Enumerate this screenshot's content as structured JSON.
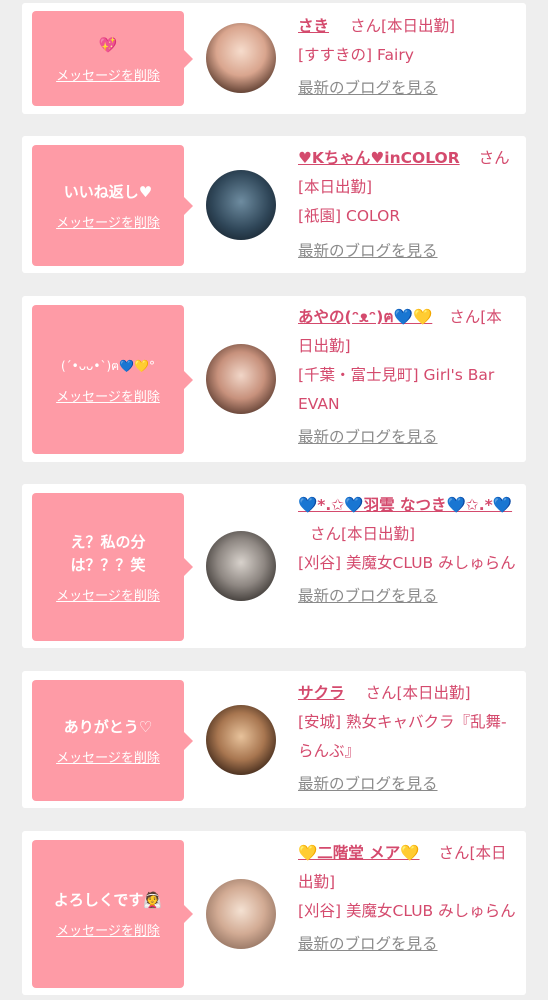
{
  "cards": [
    {
      "message": "💖",
      "delete_label": "メッセージを削除",
      "name": "さき",
      "san_status": "さん[本日出勤]",
      "shop": "[すすきの] Fairy",
      "blog_label": "最新のブログを見る"
    },
    {
      "message": "いいね返し♥",
      "delete_label": "メッセージを削除",
      "name": "♥Kちゃん♥inCOLOR",
      "san_status": "さん[本日出勤]",
      "shop": "[祇園] COLOR",
      "blog_label": "最新のブログを見る"
    },
    {
      "message": "(´•ᴗᴗ•`)ฅ💙💛°",
      "delete_label": "メッセージを削除",
      "name": "あやの(ᵔᴥᵔ)ฅ💙💛",
      "san_status": "さん[本日出勤]",
      "shop": "[千葉・富士見町] Girl's Bar EVAN",
      "blog_label": "最新のブログを見る"
    },
    {
      "message": "え？私の分は？？？笑",
      "delete_label": "メッセージを削除",
      "name": "💙*.✩💙羽雲 なつき💙✩.*💙",
      "san_status": "さん[本日出勤]",
      "shop": "[刈谷] 美魔女CLUB みしゅらん",
      "blog_label": "最新のブログを見る"
    },
    {
      "message": "ありがとう♡",
      "delete_label": "メッセージを削除",
      "name": "サクラ",
      "san_status": "さん[本日出勤]",
      "shop": "[安城] 熟女キャバクラ『乱舞-らんぶ』",
      "blog_label": "最新のブログを見る"
    },
    {
      "message": "よろしくです👰",
      "delete_label": "メッセージを削除",
      "name": "💛二階堂 メア💛",
      "san_status": "さん[本日出勤]",
      "shop": "[刈谷] 美魔女CLUB みしゅらん",
      "blog_label": "最新のブログを見る"
    }
  ],
  "colors": {
    "background": "#eeeeee",
    "card": "#ffffff",
    "bubble": "#fe9ba6",
    "name_text": "#d44a6d",
    "blog_link": "#8a8a8a"
  }
}
